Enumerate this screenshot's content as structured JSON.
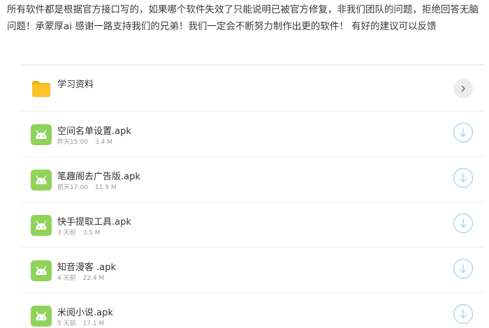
{
  "notice": "所有软件都是根据官方接口写的，如果哪个软件失效了只能说明已被官方修复，非我们团队的问题，拒绝回答无脑问题！承蒙厚ai 感谢一路支持我们的兄弟！我们一定会不断努力制作出更的软件！ 有好的建议可以反馈",
  "colors": {
    "folder": "#FDC42A",
    "android": "#8FD35B",
    "download_ring": "#9ED3F2",
    "chevron_bg": "#ECECEC"
  },
  "folder": {
    "name": "学习资料",
    "icon": "folder-icon",
    "action_icon": "chevron-right-icon"
  },
  "files": [
    {
      "name": "空间名单设置.apk",
      "time": "昨天15:00",
      "size": "3.4 M"
    },
    {
      "name": "笔趣阁去广告版.apk",
      "time": "前天17:00",
      "size": "11.9 M"
    },
    {
      "name": "快手提取工具.apk",
      "time": "3 天前",
      "size": "3.5 M"
    },
    {
      "name": "知音漫客 .apk",
      "time": "4 天前",
      "size": "22.4 M"
    },
    {
      "name": "米阅小说.apk",
      "time": "5 天前",
      "size": "17.1 M"
    }
  ],
  "file_icon": "android-apk-icon",
  "download_icon": "download-icon"
}
